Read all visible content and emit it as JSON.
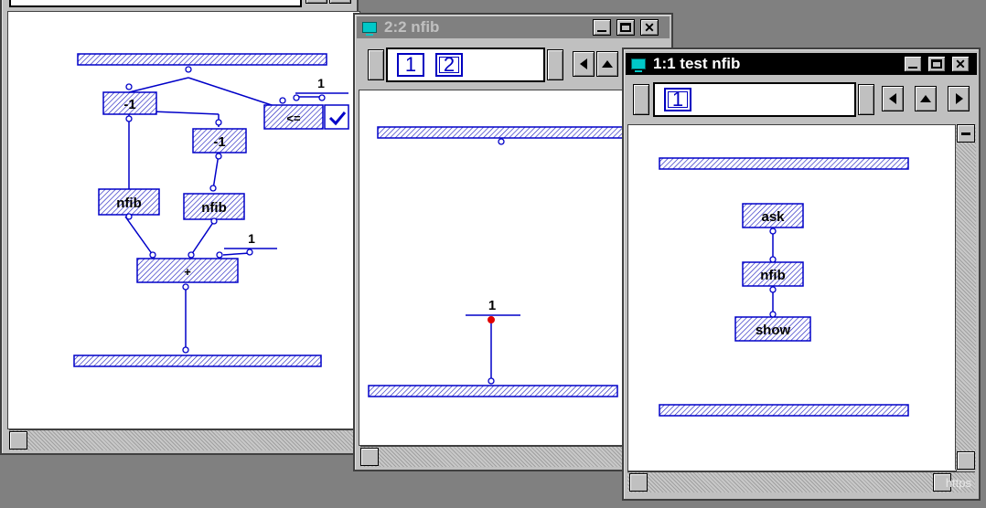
{
  "windows": {
    "left": {
      "nodes": [
        "-1",
        "-1",
        "nfib",
        "nfib",
        "<=",
        "+"
      ],
      "constants": [
        "1",
        "1"
      ]
    },
    "middle": {
      "title": "2:2 nfib",
      "tabs": [
        "1",
        "2"
      ],
      "constant": "1"
    },
    "right": {
      "title": "1:1 test nfib",
      "tabs": [
        "1"
      ],
      "nodes": [
        "ask",
        "nfib",
        "show"
      ]
    }
  },
  "colors": {
    "wire": "#0000c8",
    "active_title": "#000000",
    "inactive_title": "#808080",
    "port_active": "#e00000"
  },
  "watermark": "https"
}
